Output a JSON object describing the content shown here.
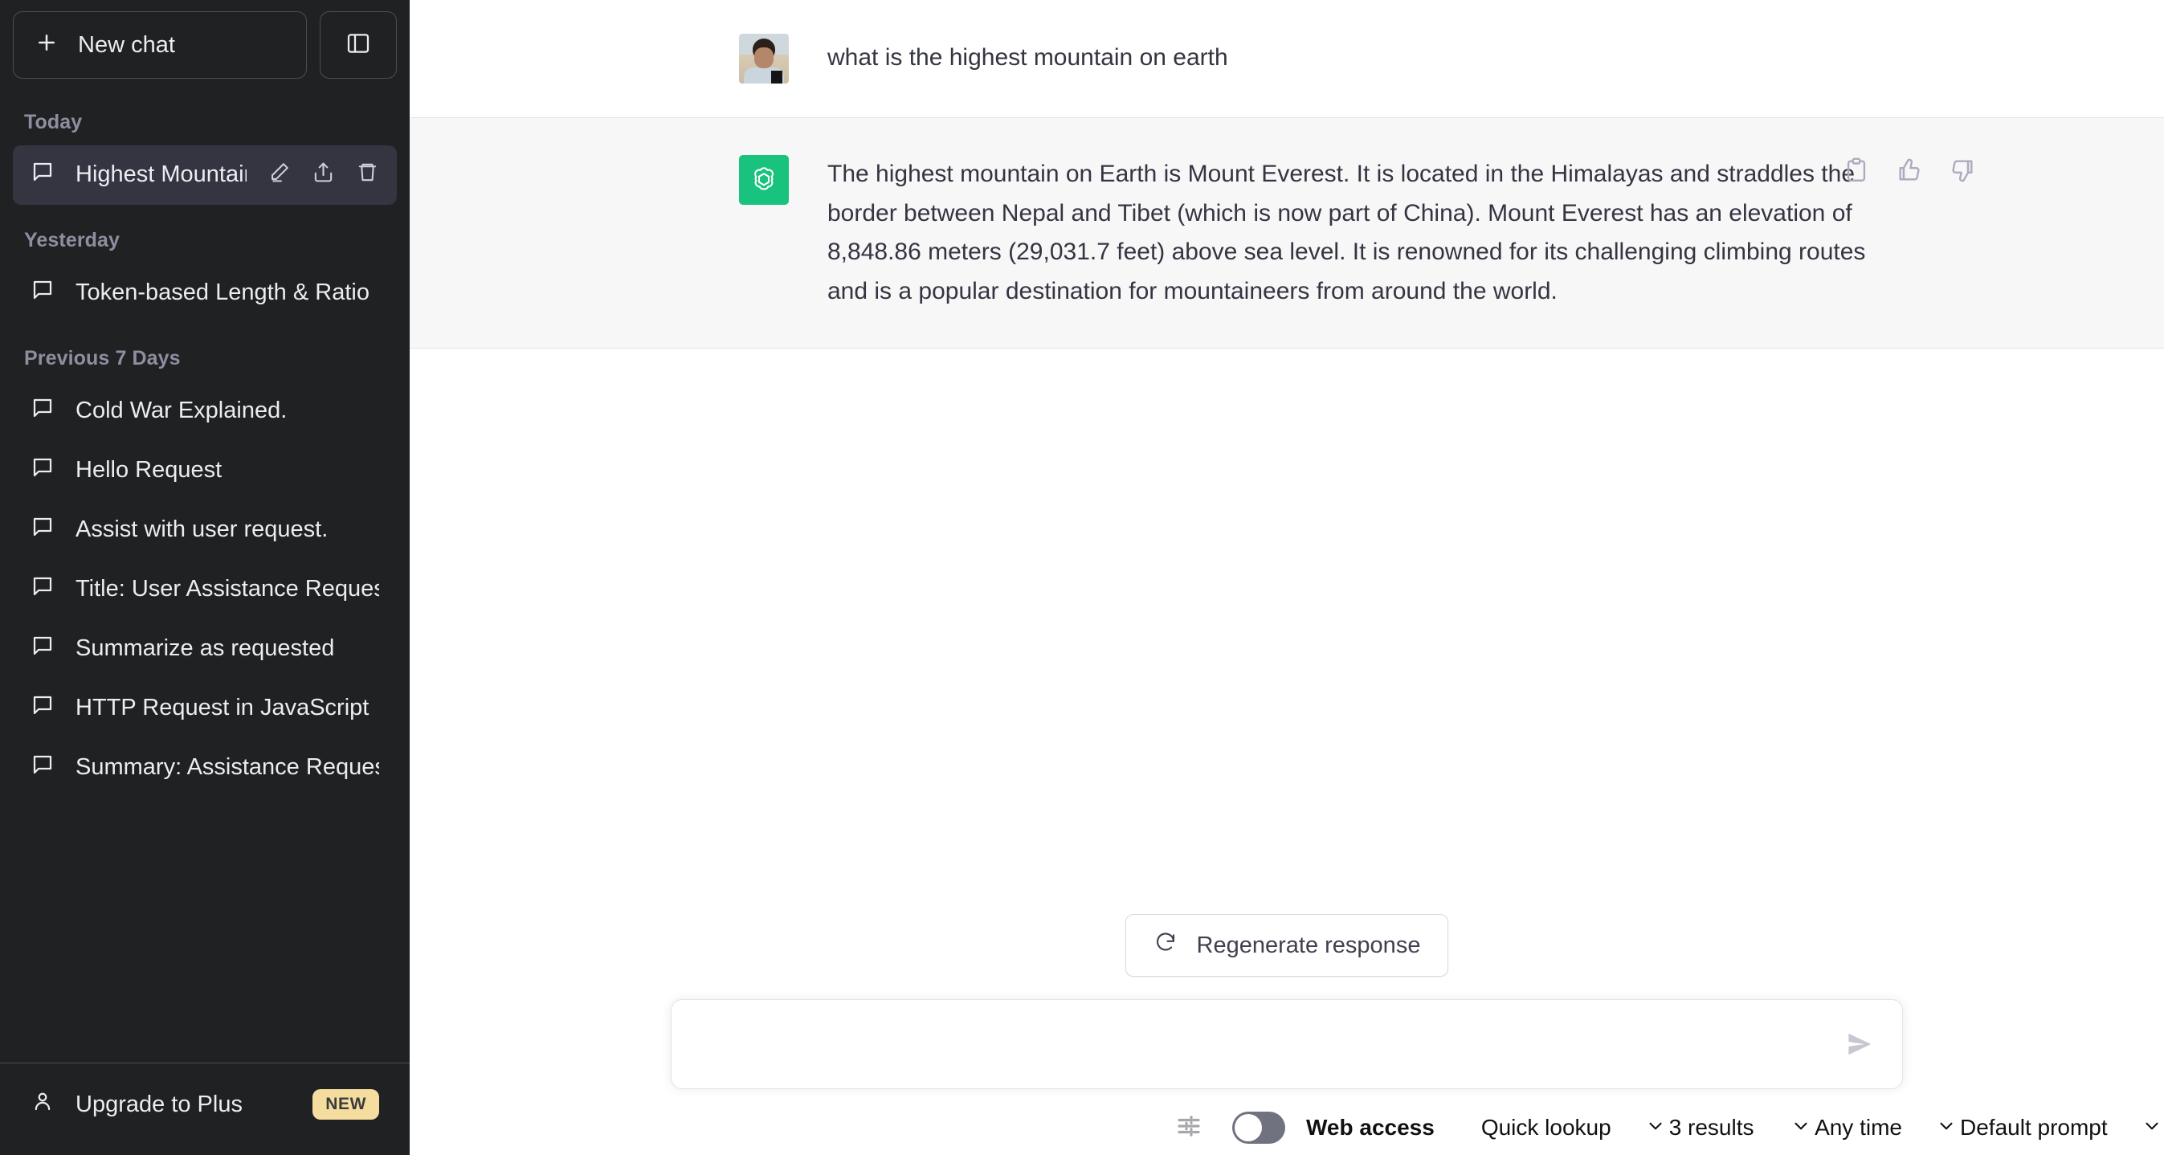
{
  "sidebar": {
    "new_chat_label": "New chat",
    "new_chat_icon": "plus-icon",
    "collapse_icon": "sidebar-collapse-icon",
    "groups": [
      {
        "label": "Today",
        "items": [
          {
            "title": "Highest Mountain: M",
            "active": true,
            "icon": "chat-bubble-icon",
            "actions": [
              "edit-icon",
              "share-icon",
              "trash-icon"
            ]
          }
        ]
      },
      {
        "label": "Yesterday",
        "items": [
          {
            "title": "Token-based Length & Ratio",
            "active": false,
            "icon": "chat-bubble-icon"
          }
        ]
      },
      {
        "label": "Previous 7 Days",
        "items": [
          {
            "title": "Cold War Explained.",
            "active": false,
            "icon": "chat-bubble-icon"
          },
          {
            "title": "Hello Request",
            "active": false,
            "icon": "chat-bubble-icon"
          },
          {
            "title": "Assist with user request.",
            "active": false,
            "icon": "chat-bubble-icon"
          },
          {
            "title": "Title: User Assistance Request",
            "active": false,
            "icon": "chat-bubble-icon"
          },
          {
            "title": "Summarize as requested",
            "active": false,
            "icon": "chat-bubble-icon"
          },
          {
            "title": "HTTP Request in JavaScript",
            "active": false,
            "icon": "chat-bubble-icon"
          },
          {
            "title": "Summary: Assistance Request",
            "active": false,
            "icon": "chat-bubble-icon"
          }
        ]
      }
    ],
    "upgrade": {
      "label": "Upgrade to Plus",
      "icon": "person-icon",
      "badge": "NEW",
      "badge_color": "#f5dd9f"
    }
  },
  "conversation": {
    "messages": [
      {
        "role": "user",
        "avatar": "user-photo-avatar",
        "text": "what is the highest mountain on earth"
      },
      {
        "role": "assistant",
        "avatar": "openai-logo-icon",
        "avatar_color": "#19c37d",
        "text": "The highest mountain on Earth is Mount Everest. It is located in the Himalayas and straddles the border between Nepal and Tibet (which is now part of China). Mount Everest has an elevation of 8,848.86 meters (29,031.7 feet) above sea level. It is renowned for its challenging climbing routes and is a popular destination for mountaineers from around the world.",
        "actions": [
          "copy-icon",
          "thumbs-up-icon",
          "thumbs-down-icon"
        ]
      }
    ]
  },
  "composer": {
    "regenerate_label": "Regenerate response",
    "regenerate_icon": "refresh-icon",
    "input_value": "",
    "input_placeholder": "",
    "send_icon": "send-icon"
  },
  "toolbar": {
    "settings_icon": "sliders-icon",
    "web_access_label": "Web access",
    "web_access_enabled": false,
    "selects": [
      {
        "name": "search-mode",
        "value": "Quick lookup",
        "chevron": "chevron-down-icon"
      },
      {
        "name": "result-count",
        "value": "3 results",
        "chevron": "chevron-down-icon"
      },
      {
        "name": "time-range",
        "value": "Any time",
        "chevron": "chevron-down-icon"
      },
      {
        "name": "prompt-template",
        "value": "Default prompt",
        "chevron": "chevron-down-icon"
      }
    ]
  }
}
